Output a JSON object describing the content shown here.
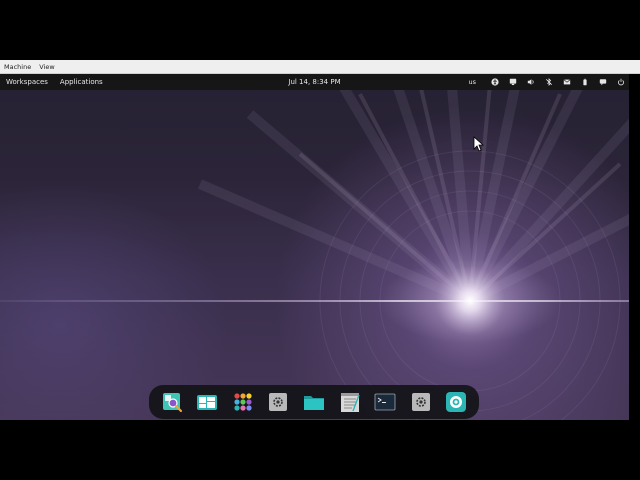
{
  "host_menu": {
    "items": [
      "Machine",
      "View"
    ]
  },
  "topbar": {
    "workspaces_label": "Workspaces",
    "applications_label": "Applications",
    "clock": "Jul 14, 8:34 PM",
    "keyboard_layout": "us",
    "tray_icons": [
      "accessibility-icon",
      "network-icon",
      "volume-icon",
      "bluetooth-off-icon",
      "mail-icon",
      "battery-icon",
      "notifications-icon",
      "power-icon"
    ]
  },
  "dock": {
    "apps": [
      "search-app-icon",
      "window-switcher-icon",
      "app-grid-icon",
      "settings-app-icon",
      "files-folder-icon",
      "text-editor-icon",
      "terminal-icon",
      "system-settings-icon",
      "screen-recorder-icon"
    ]
  },
  "colors": {
    "topbar_bg": "#161616",
    "dock_bg": "#141418",
    "accent_teal": "#2bb5b5",
    "wallpaper_glow": "#f4eef8"
  }
}
